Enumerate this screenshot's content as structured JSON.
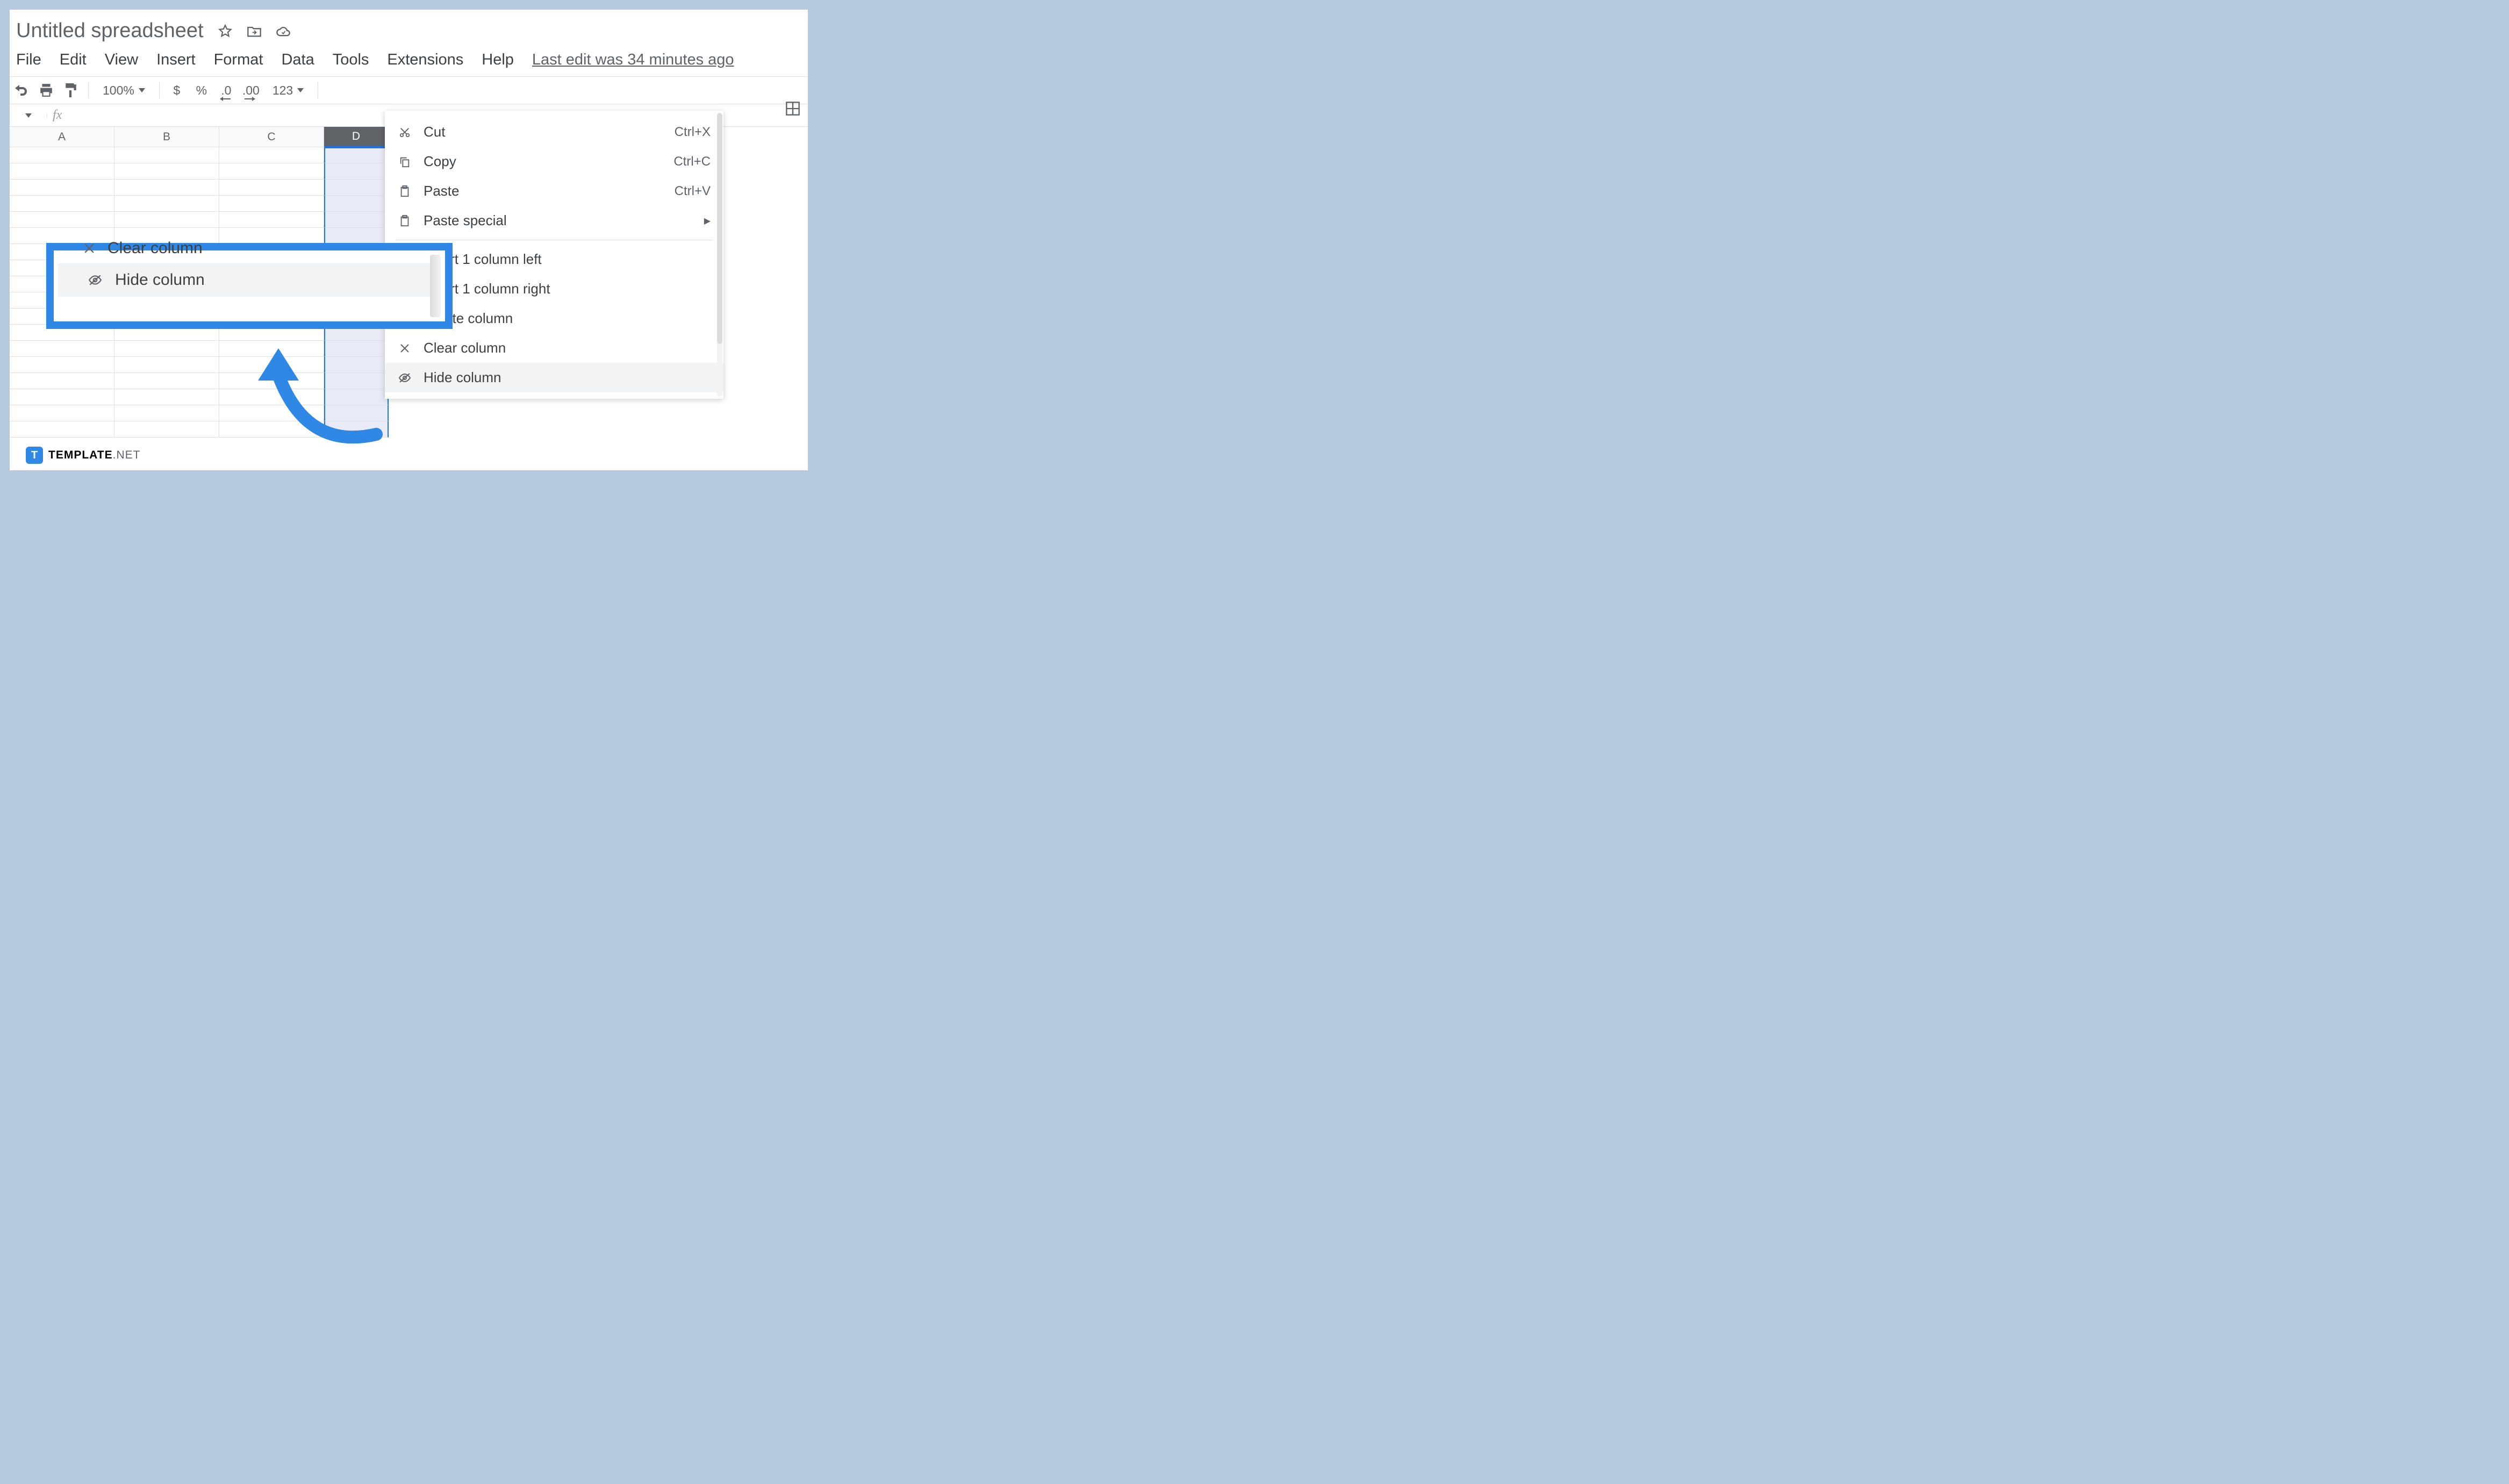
{
  "title": "Untitled spreadsheet",
  "menu": {
    "file": "File",
    "edit": "Edit",
    "view": "View",
    "insert": "Insert",
    "format": "Format",
    "data": "Data",
    "tools": "Tools",
    "extensions": "Extensions",
    "help": "Help"
  },
  "lastedit": "Last edit was 34 minutes ago",
  "toolbar": {
    "zoom": "100%",
    "cur": "$",
    "pct": "%",
    "d0": ".0",
    "d00": ".00",
    "f123": "123"
  },
  "fx": "fx",
  "cols": {
    "a": "A",
    "b": "B",
    "c": "C",
    "d": "D"
  },
  "ctx": {
    "cut": "Cut",
    "cut_sc": "Ctrl+X",
    "copy": "Copy",
    "copy_sc": "Ctrl+C",
    "paste": "Paste",
    "paste_sc": "Ctrl+V",
    "pastesp": "Paste special",
    "insleft": "Insert 1 column left",
    "insright": "Insert 1 column right",
    "delcol": "Delete column",
    "clrcol": "Clear column",
    "hidecol": "Hide column"
  },
  "callout": {
    "clear": "Clear column",
    "hide": "Hide column"
  },
  "brand": {
    "icon": "T",
    "b": "TEMPLATE",
    "n": ".NET"
  }
}
